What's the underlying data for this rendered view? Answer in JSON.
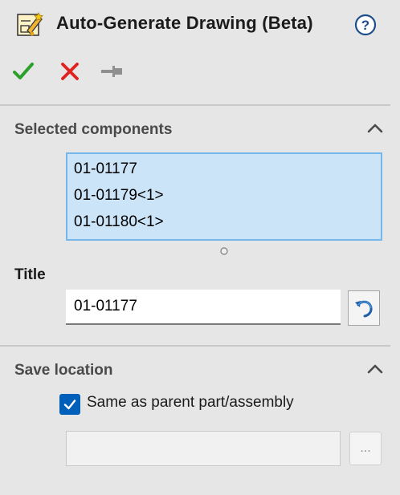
{
  "header": {
    "title": "Auto-Generate Drawing (Beta)",
    "app_icon": "auto-generate-drawing-icon",
    "help_icon": "help-icon"
  },
  "toolbar": {
    "ok_icon": "checkmark-icon",
    "cancel_icon": "close-icon",
    "pin_icon": "pushpin-icon"
  },
  "selected_components": {
    "title": "Selected components",
    "items": [
      "01-01177",
      "01-01179<1>",
      "01-01180<1>"
    ]
  },
  "title_field": {
    "label": "Title",
    "value": "01-01177",
    "reset_icon": "undo-icon"
  },
  "save_location": {
    "title": "Save location",
    "checkbox_label": "Same as parent part/assembly",
    "checkbox_checked": true,
    "path_value": "",
    "browse_label": "..."
  },
  "colors": {
    "accent": "#005fb8",
    "ok_green": "#2ca02c",
    "cancel_red": "#e0231f",
    "list_selection": "#cce4f7"
  }
}
